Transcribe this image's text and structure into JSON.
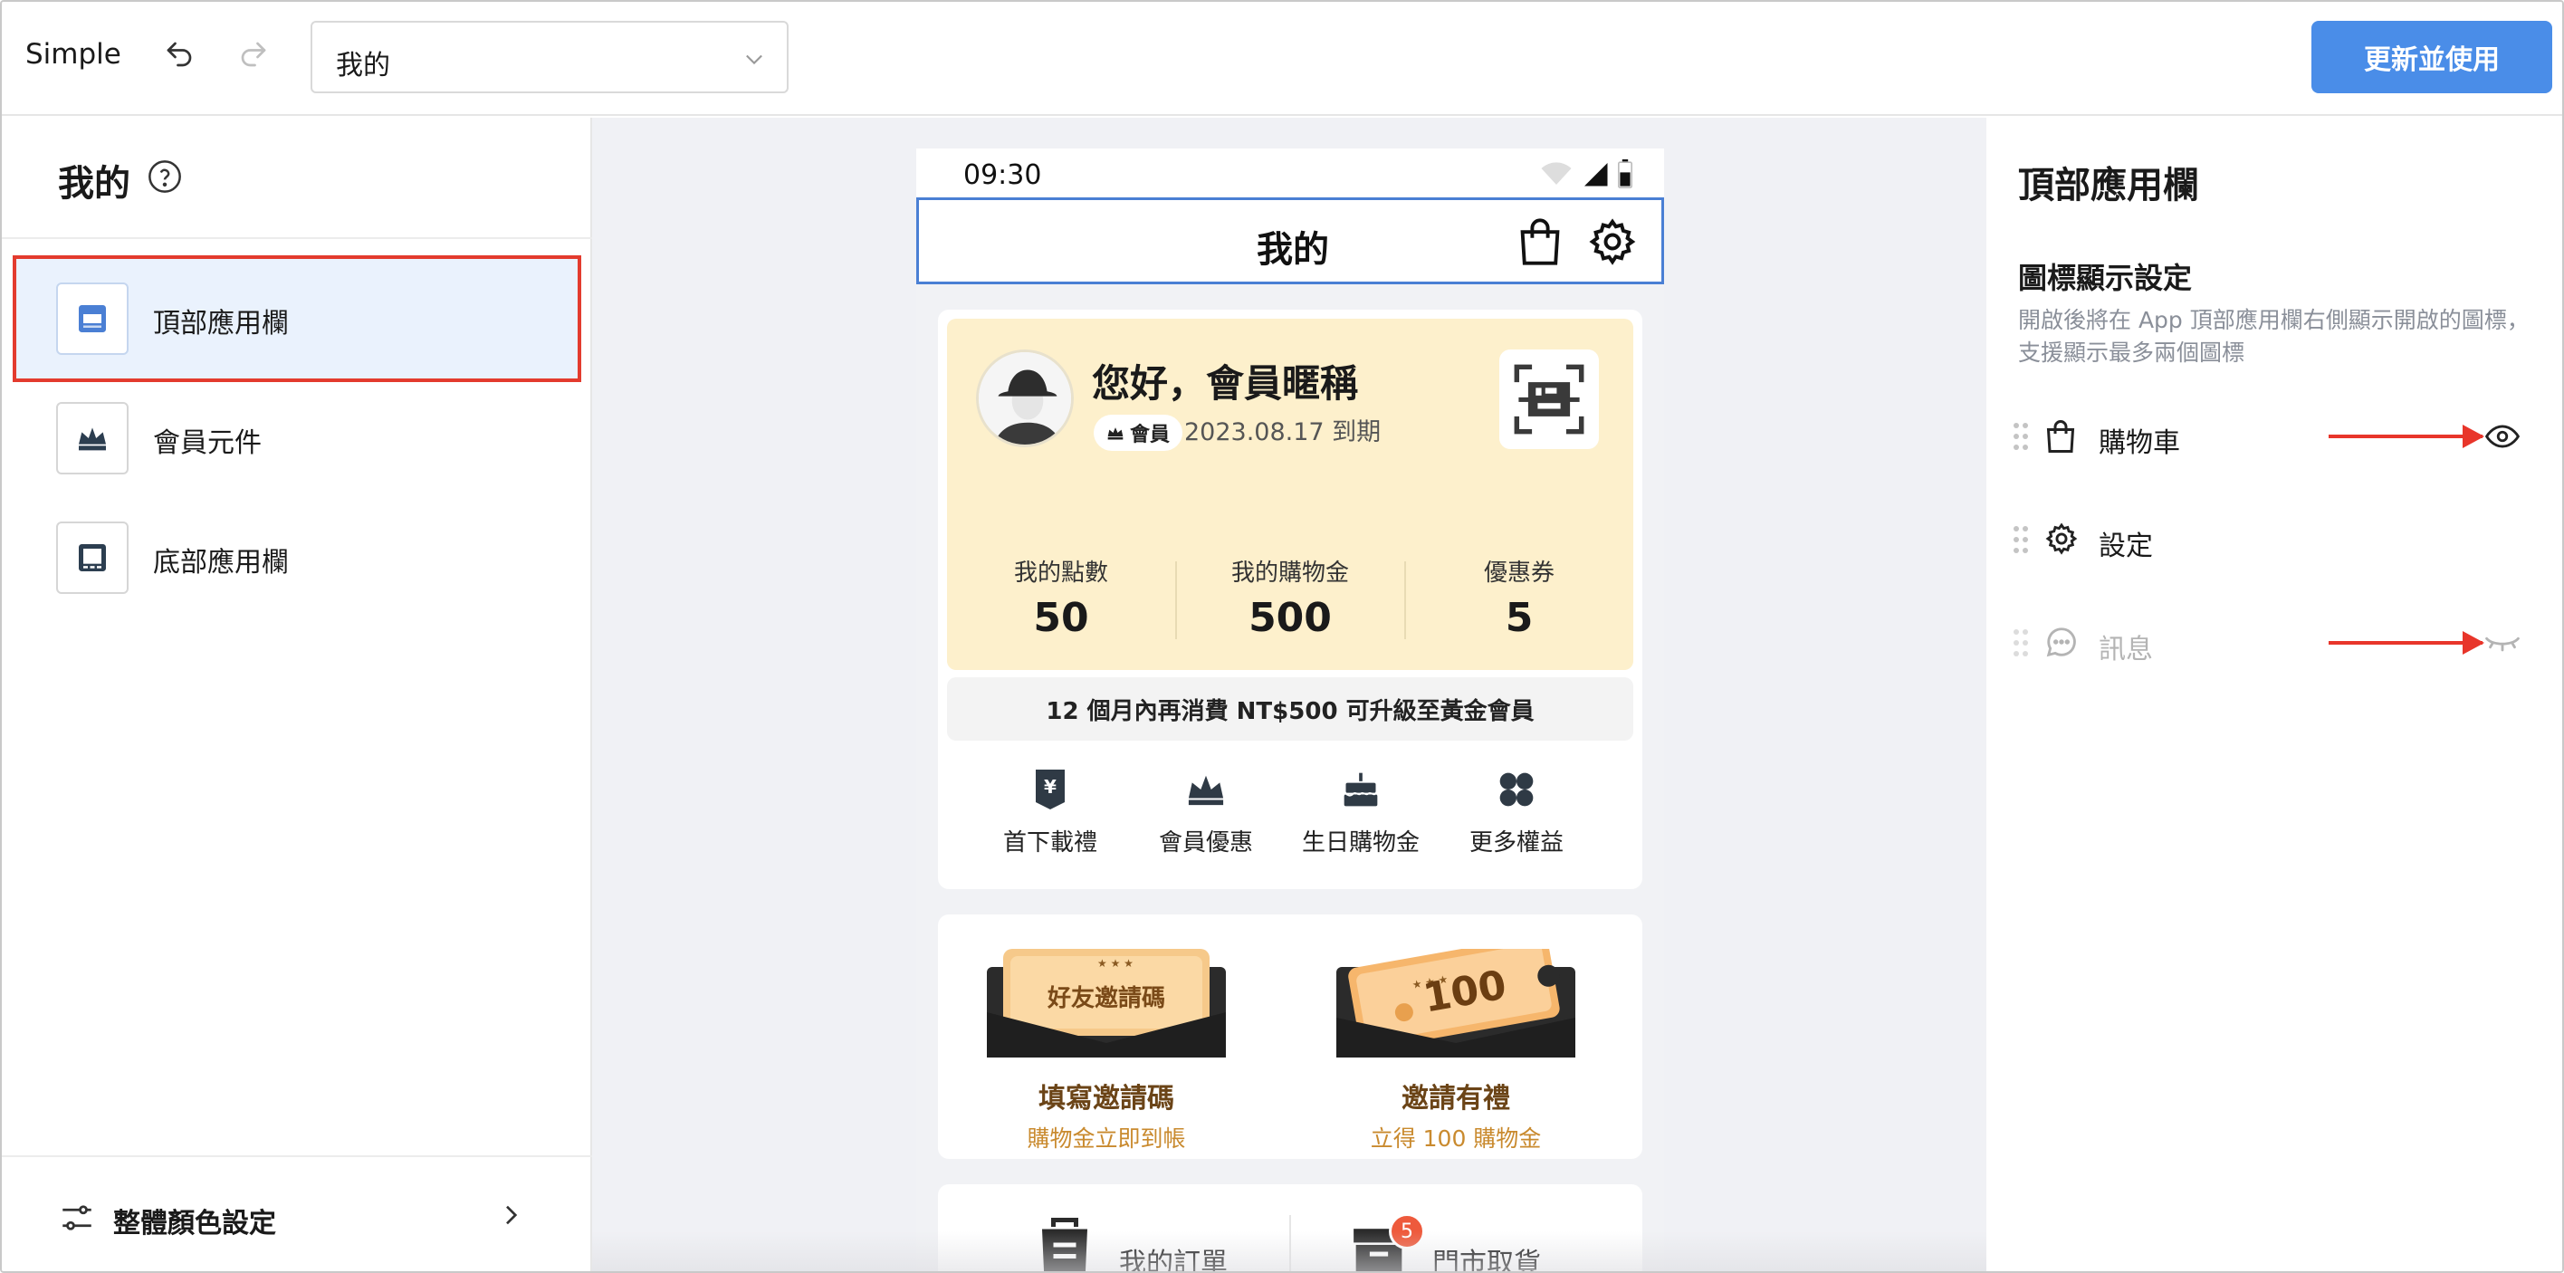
{
  "topbar": {
    "app_title": "Simple",
    "page_select_value": "我的",
    "publish_label": "更新並使用"
  },
  "left_panel": {
    "title": "我的",
    "components": [
      {
        "label": "頂部應用欄",
        "icon": "app-bar-icon",
        "selected": true
      },
      {
        "label": "會員元件",
        "icon": "crown-icon",
        "selected": false
      },
      {
        "label": "底部應用欄",
        "icon": "bottom-bar-icon",
        "selected": false
      }
    ],
    "footer_label": "整體顏色設定"
  },
  "preview": {
    "status_time": "09:30",
    "appbar_title": "我的",
    "greeting": "您好，會員暱稱",
    "tier_label": "會員",
    "expiry": "2023.08.17 到期",
    "stats": [
      {
        "label": "我的點數",
        "value": "50"
      },
      {
        "label": "我的購物金",
        "value": "500"
      },
      {
        "label": "優惠券",
        "value": "5"
      }
    ],
    "upgrade_text": "12 個月內再消費 NT$500 可升級至黃金會員",
    "benefits": [
      {
        "label": "首下載禮",
        "icon": "gift-yen-icon"
      },
      {
        "label": "會員優惠",
        "icon": "crown-icon"
      },
      {
        "label": "生日購物金",
        "icon": "cake-icon"
      },
      {
        "label": "更多權益",
        "icon": "grid-icon"
      }
    ],
    "invites": [
      {
        "art_text": "好友邀請碼",
        "title": "填寫邀請碼",
        "subtitle": "購物金立即到帳"
      },
      {
        "art_text": "100",
        "title": "邀請有禮",
        "subtitle": "立得 100 購物金"
      }
    ],
    "orders": [
      {
        "label": "我的訂單",
        "icon": "order-bag-icon"
      },
      {
        "label": "門市取貨",
        "icon": "store-box-icon",
        "badge": "5"
      }
    ]
  },
  "right_panel": {
    "title": "頂部應用欄",
    "section_title": "圖標顯示設定",
    "section_desc": "開啟後將在 App 頂部應用欄右側顯示開啟的圖標，支援顯示最多兩個圖標",
    "icons": [
      {
        "label": "購物車",
        "icon": "shopping-bag-icon",
        "visible": true
      },
      {
        "label": "設定",
        "icon": "gear-icon",
        "visible": true
      },
      {
        "label": "訊息",
        "icon": "chat-icon",
        "visible": false
      }
    ]
  },
  "colors": {
    "accent": "#4a8de8",
    "highlight_border": "#e33b2e",
    "member_card_bg": "#fdf0cc",
    "annotation_arrow": "#e8352a",
    "badge": "#ee5a3c"
  }
}
